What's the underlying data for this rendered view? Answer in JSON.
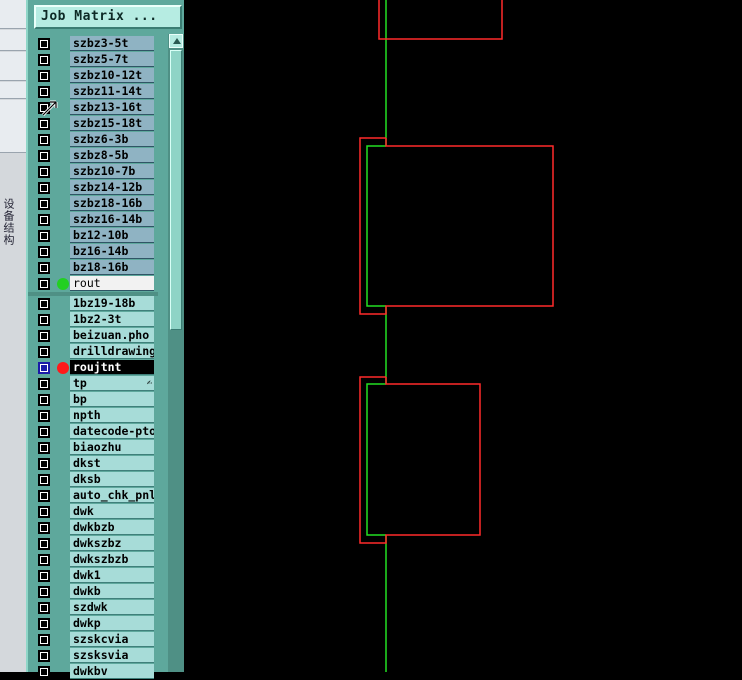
{
  "panel": {
    "title_button": "Job Matrix ...",
    "group1_rows": [
      {
        "label": "szbz3-5t"
      },
      {
        "label": "szbz5-7t"
      },
      {
        "label": "szbz10-12t"
      },
      {
        "label": "szbz11-14t"
      },
      {
        "label": "szbz13-16t"
      },
      {
        "label": "szbz15-18t"
      },
      {
        "label": "szbz6-3b"
      },
      {
        "label": "szbz8-5b"
      },
      {
        "label": "szbz10-7b"
      },
      {
        "label": "szbz14-12b"
      },
      {
        "label": "szbz18-16b"
      },
      {
        "label": "szbz16-14b"
      },
      {
        "label": "bz12-10b"
      },
      {
        "label": "bz16-14b"
      },
      {
        "label": "bz18-16b"
      },
      {
        "label": "rout",
        "dot": "#22d022",
        "highlight": true
      }
    ],
    "group2_rows": [
      {
        "label": "1bz19-18b"
      },
      {
        "label": "1bz2-3t"
      },
      {
        "label": "beizuan.pho"
      },
      {
        "label": "drilldrawing"
      },
      {
        "label": "roujtnt",
        "dot": "#ff1a1a",
        "selected": true
      },
      {
        "label": "tp"
      },
      {
        "label": "bp"
      },
      {
        "label": "npth"
      },
      {
        "label": "datecode-pto"
      },
      {
        "label": "biaozhu"
      },
      {
        "label": "dkst"
      },
      {
        "label": "dksb"
      },
      {
        "label": "auto_chk_pnl"
      },
      {
        "label": "dwk"
      },
      {
        "label": "dwkbzb"
      },
      {
        "label": "dwkszbz"
      },
      {
        "label": "dwkszbzb"
      },
      {
        "label": "dwk1"
      },
      {
        "label": "dwkb"
      },
      {
        "label": "szdwk"
      },
      {
        "label": "dwkp"
      },
      {
        "label": "szskcvia"
      },
      {
        "label": "szsksvia"
      },
      {
        "label": "dwkbv"
      }
    ]
  },
  "left_strip": {
    "vertical_text": "设备结构"
  },
  "colors": {
    "outline": "#ff2a2a",
    "rout_path": "#22e022",
    "background": "#000000",
    "panel": "#5ea89c"
  }
}
